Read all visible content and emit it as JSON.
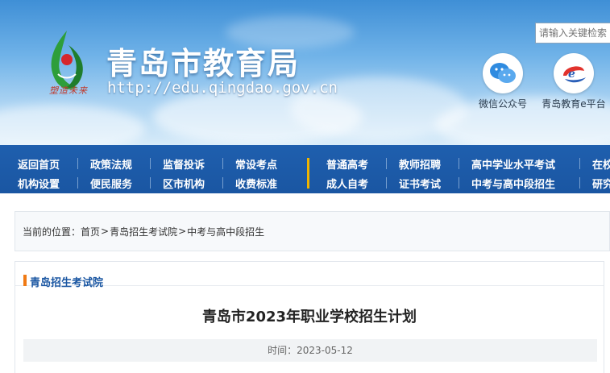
{
  "header": {
    "site_title": "青岛市教育局",
    "site_url": "http://edu.qingdao.gov.cn",
    "logo_slogan": "塑造未来",
    "search": {
      "placeholder": "请输入关键检索"
    },
    "qr_wechat_label": "微信公众号",
    "qr_eplatform_label": "青岛教育e平台"
  },
  "nav": {
    "row1": [
      "返回首页",
      "政策法规",
      "监督投诉",
      "常设考点",
      "普通高考",
      "教师招聘",
      "高中学业水平考试",
      "在校"
    ],
    "row2": [
      "机构设置",
      "便民服务",
      "区市机构",
      "收费标准",
      "成人自考",
      "证书考试",
      "中考与高中段招生",
      "研究"
    ]
  },
  "breadcrumb": {
    "prefix": "当前的位置：",
    "items": [
      "首页",
      "青岛招生考试院",
      "中考与高中段招生"
    ],
    "separator": ">"
  },
  "panel": {
    "section_title": "青岛招生考试院",
    "article_title": "青岛市2023年职业学校招生计划",
    "meta": "时间：2023-05-12"
  },
  "colors": {
    "nav_bg": "#1a56a2",
    "accent_orange": "#f07a14",
    "divider_yellow": "#f0b400",
    "title_blue": "#1a56a2"
  }
}
